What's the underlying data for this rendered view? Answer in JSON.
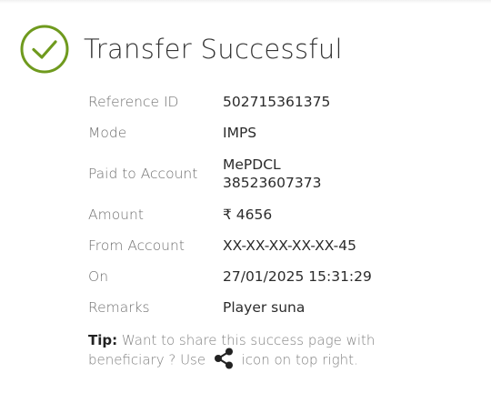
{
  "header": {
    "title": "Transfer Successful",
    "icon": "check-circle-icon",
    "icon_color": "#6f9a1e"
  },
  "details": [
    {
      "label": "Reference ID",
      "value": [
        "502715361375"
      ]
    },
    {
      "label": "Mode",
      "value": [
        "IMPS"
      ]
    },
    {
      "label": "Paid to Account",
      "value": [
        "MePDCL",
        "38523607373"
      ]
    },
    {
      "label": "Amount",
      "value": [
        "₹ 4656"
      ]
    },
    {
      "label": "From Account",
      "value": [
        "XX-XX-XX-XX-XX-45"
      ]
    },
    {
      "label": "On",
      "value": [
        "27/01/2025 15:31:29"
      ]
    },
    {
      "label": "Remarks",
      "value": [
        "Player suna"
      ]
    }
  ],
  "tip": {
    "prefix": "Tip:",
    "text_before_icon": " Want to share this success page with beneficiary ? Use ",
    "icon": "share-icon",
    "text_after_icon": " icon on top right."
  }
}
